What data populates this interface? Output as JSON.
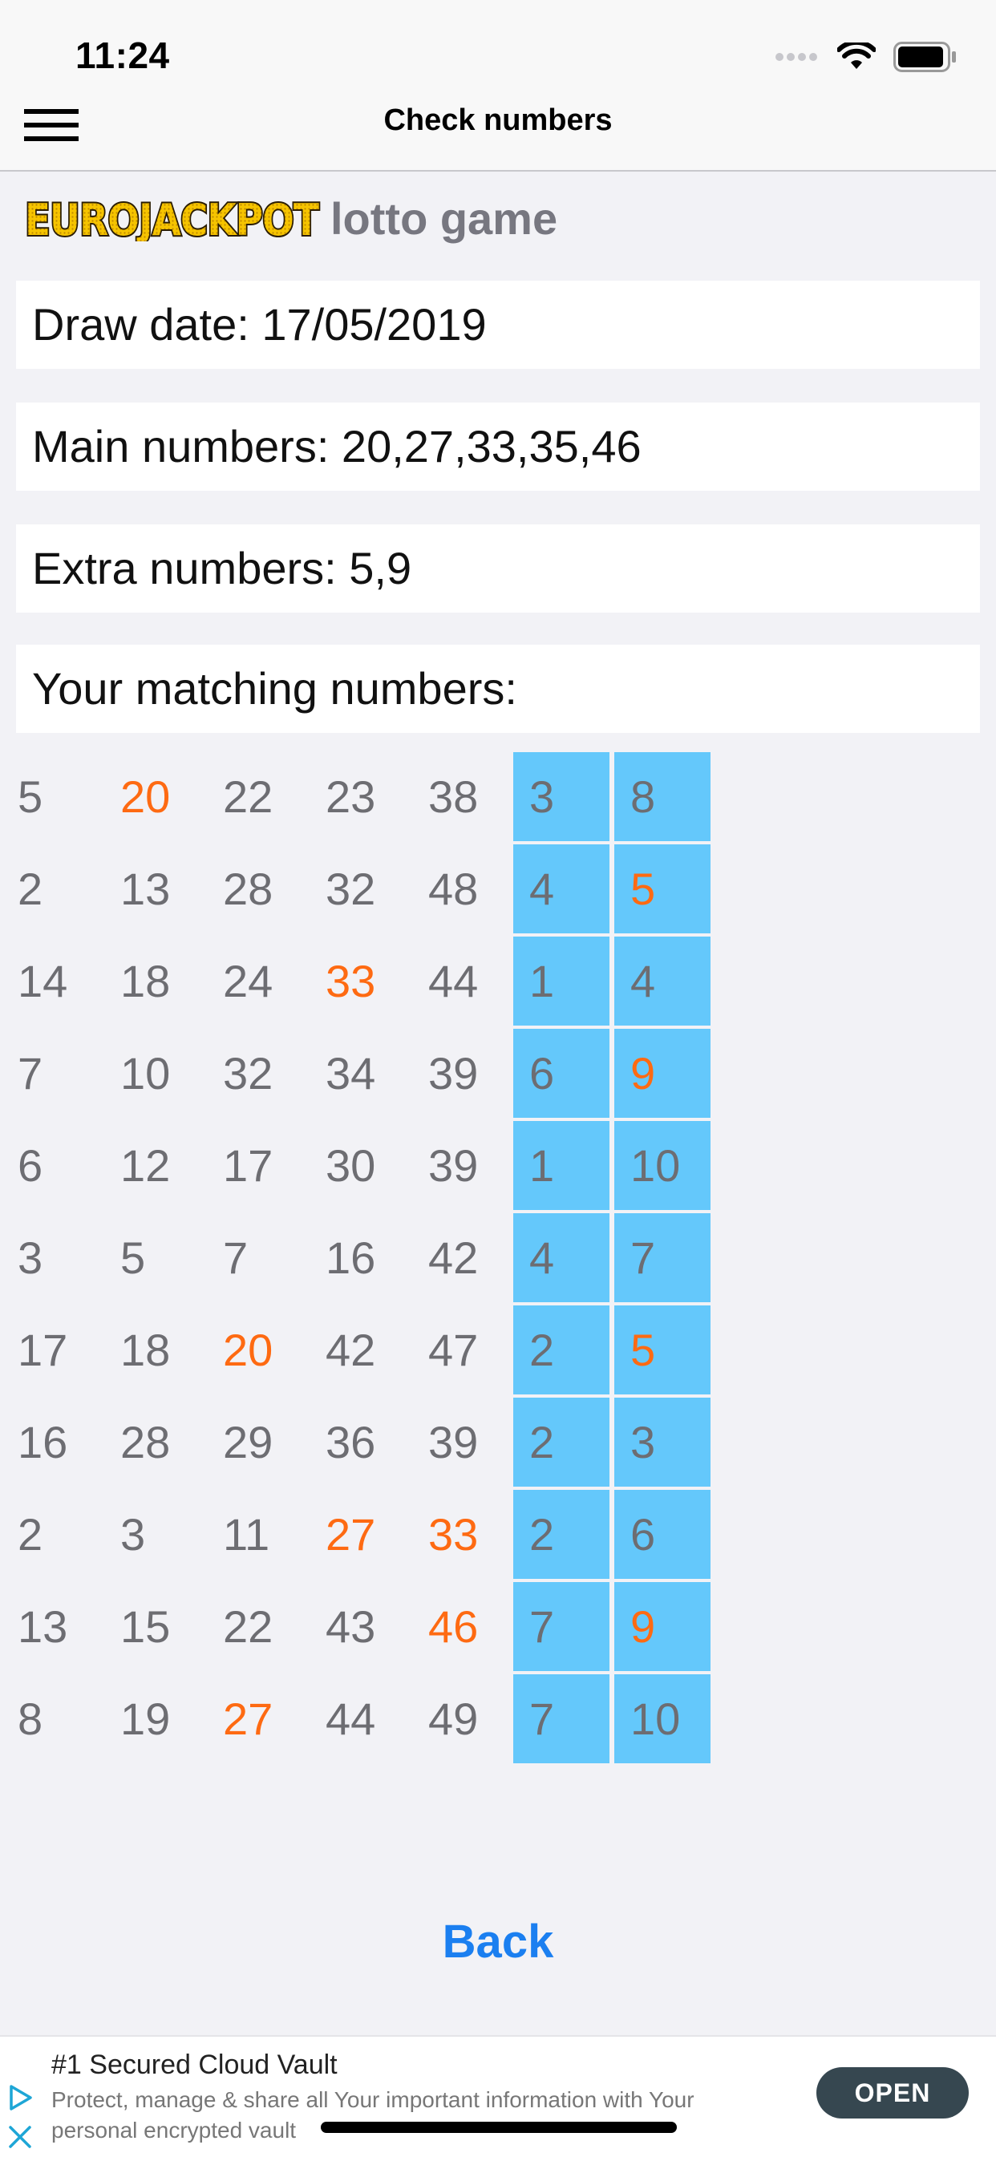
{
  "status_bar": {
    "time": "11:24"
  },
  "nav": {
    "title": "Check numbers"
  },
  "brand": {
    "logo_text": "EUROJACKPOT",
    "suffix": "lotto game"
  },
  "draw": {
    "date_line": "Draw date: 17/05/2019",
    "main_line": "Main numbers: 20,27,33,35,46",
    "extra_line": "Extra numbers: 5,9",
    "matching_label": "Your matching numbers:"
  },
  "colors": {
    "hit": "#fe6a12",
    "extra_bg": "#64c8fb",
    "link": "#1b7ff0",
    "number": "#6d6d72"
  },
  "ticket_rows": [
    {
      "main": [
        {
          "n": "5",
          "hit": false
        },
        {
          "n": "20",
          "hit": true
        },
        {
          "n": "22",
          "hit": false
        },
        {
          "n": "23",
          "hit": false
        },
        {
          "n": "38",
          "hit": false
        }
      ],
      "extra": [
        {
          "n": "3",
          "hit": false
        },
        {
          "n": "8",
          "hit": false
        }
      ]
    },
    {
      "main": [
        {
          "n": "2",
          "hit": false
        },
        {
          "n": "13",
          "hit": false
        },
        {
          "n": "28",
          "hit": false
        },
        {
          "n": "32",
          "hit": false
        },
        {
          "n": "48",
          "hit": false
        }
      ],
      "extra": [
        {
          "n": "4",
          "hit": false
        },
        {
          "n": "5",
          "hit": true
        }
      ]
    },
    {
      "main": [
        {
          "n": "14",
          "hit": false
        },
        {
          "n": "18",
          "hit": false
        },
        {
          "n": "24",
          "hit": false
        },
        {
          "n": "33",
          "hit": true
        },
        {
          "n": "44",
          "hit": false
        }
      ],
      "extra": [
        {
          "n": "1",
          "hit": false
        },
        {
          "n": "4",
          "hit": false
        }
      ]
    },
    {
      "main": [
        {
          "n": "7",
          "hit": false
        },
        {
          "n": "10",
          "hit": false
        },
        {
          "n": "32",
          "hit": false
        },
        {
          "n": "34",
          "hit": false
        },
        {
          "n": "39",
          "hit": false
        }
      ],
      "extra": [
        {
          "n": "6",
          "hit": false
        },
        {
          "n": "9",
          "hit": true
        }
      ]
    },
    {
      "main": [
        {
          "n": "6",
          "hit": false
        },
        {
          "n": "12",
          "hit": false
        },
        {
          "n": "17",
          "hit": false
        },
        {
          "n": "30",
          "hit": false
        },
        {
          "n": "39",
          "hit": false
        }
      ],
      "extra": [
        {
          "n": "1",
          "hit": false
        },
        {
          "n": "10",
          "hit": false
        }
      ]
    },
    {
      "main": [
        {
          "n": "3",
          "hit": false
        },
        {
          "n": "5",
          "hit": false
        },
        {
          "n": "7",
          "hit": false
        },
        {
          "n": "16",
          "hit": false
        },
        {
          "n": "42",
          "hit": false
        }
      ],
      "extra": [
        {
          "n": "4",
          "hit": false
        },
        {
          "n": "7",
          "hit": false
        }
      ]
    },
    {
      "main": [
        {
          "n": "17",
          "hit": false
        },
        {
          "n": "18",
          "hit": false
        },
        {
          "n": "20",
          "hit": true
        },
        {
          "n": "42",
          "hit": false
        },
        {
          "n": "47",
          "hit": false
        }
      ],
      "extra": [
        {
          "n": "2",
          "hit": false
        },
        {
          "n": "5",
          "hit": true
        }
      ]
    },
    {
      "main": [
        {
          "n": "16",
          "hit": false
        },
        {
          "n": "28",
          "hit": false
        },
        {
          "n": "29",
          "hit": false
        },
        {
          "n": "36",
          "hit": false
        },
        {
          "n": "39",
          "hit": false
        }
      ],
      "extra": [
        {
          "n": "2",
          "hit": false
        },
        {
          "n": "3",
          "hit": false
        }
      ]
    },
    {
      "main": [
        {
          "n": "2",
          "hit": false
        },
        {
          "n": "3",
          "hit": false
        },
        {
          "n": "11",
          "hit": false
        },
        {
          "n": "27",
          "hit": true
        },
        {
          "n": "33",
          "hit": true
        }
      ],
      "extra": [
        {
          "n": "2",
          "hit": false
        },
        {
          "n": "6",
          "hit": false
        }
      ]
    },
    {
      "main": [
        {
          "n": "13",
          "hit": false
        },
        {
          "n": "15",
          "hit": false
        },
        {
          "n": "22",
          "hit": false
        },
        {
          "n": "43",
          "hit": false
        },
        {
          "n": "46",
          "hit": true
        }
      ],
      "extra": [
        {
          "n": "7",
          "hit": false
        },
        {
          "n": "9",
          "hit": true
        }
      ]
    },
    {
      "main": [
        {
          "n": "8",
          "hit": false
        },
        {
          "n": "19",
          "hit": false
        },
        {
          "n": "27",
          "hit": true
        },
        {
          "n": "44",
          "hit": false
        },
        {
          "n": "49",
          "hit": false
        }
      ],
      "extra": [
        {
          "n": "7",
          "hit": false
        },
        {
          "n": "10",
          "hit": false
        }
      ]
    }
  ],
  "actions": {
    "back_label": "Back"
  },
  "ad": {
    "title": "#1 Secured Cloud Vault",
    "body": "Protect, manage & share all Your important information with Your personal encrypted vault",
    "cta": "OPEN"
  }
}
